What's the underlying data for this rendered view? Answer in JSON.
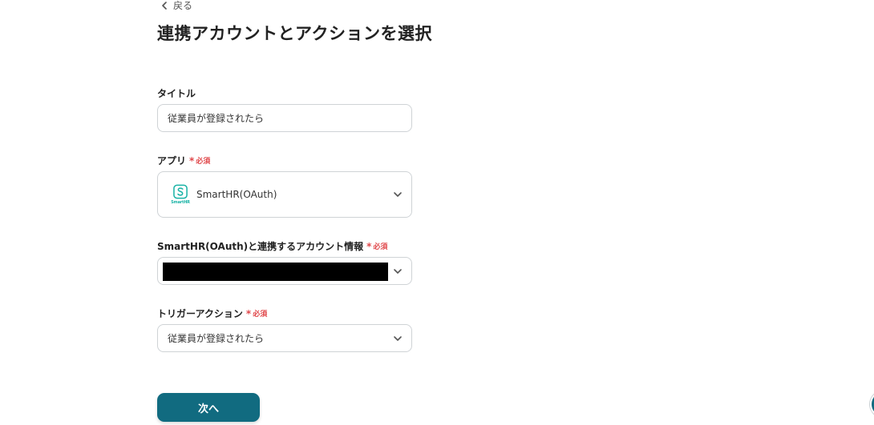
{
  "header": {
    "back_label": "戻る",
    "title": "連携アカウントとアクションを選択"
  },
  "form": {
    "title_field": {
      "label": "タイトル",
      "value": "従業員が登録されたら"
    },
    "app_field": {
      "label": "アプリ",
      "required_label": "必須",
      "value": "SmartHR(OAuth)",
      "logo_text": "SmartHR",
      "logo_icon": "smarthr-s-logo-icon"
    },
    "account_field": {
      "label": "SmartHR(OAuth)と連携するアカウント情報",
      "required_label": "必須"
    },
    "trigger_field": {
      "label": "トリガーアクション",
      "required_label": "必須",
      "value": "従業員が登録されたら"
    }
  },
  "actions": {
    "next_label": "次へ"
  },
  "colors": {
    "primary": "#116b80",
    "required": "#e0484b",
    "smarthr_brand": "#1ab3a6",
    "border": "#cfd3d6"
  }
}
